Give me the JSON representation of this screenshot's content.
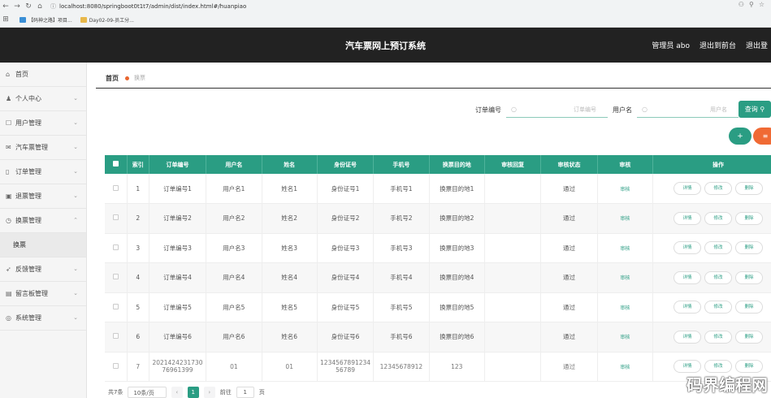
{
  "browser": {
    "url": "localhost:8080/springboot0t1t7/admin/dist/index.html#/huanpiao",
    "bookmarks": [
      "【码神之路】项目...",
      "Day02-09-员工分..."
    ]
  },
  "header": {
    "title": "汽车票网上预订系统",
    "admin": "管理员 abo",
    "back_front": "退出到前台",
    "logout": "退出登"
  },
  "sidebar": {
    "items": [
      {
        "label": "首页",
        "icon": "home-icon",
        "chev": false
      },
      {
        "label": "个人中心",
        "icon": "user-icon",
        "chev": true
      },
      {
        "label": "用户管理",
        "icon": "users-icon",
        "chev": true
      },
      {
        "label": "汽车票管理",
        "icon": "ticket-icon",
        "chev": true
      },
      {
        "label": "订单管理",
        "icon": "order-icon",
        "chev": true
      },
      {
        "label": "退票管理",
        "icon": "refund-icon",
        "chev": true
      },
      {
        "label": "换票管理",
        "icon": "exchange-icon",
        "chev": true,
        "open": true
      },
      {
        "label": "换票",
        "sub": true
      },
      {
        "label": "反馈管理",
        "icon": "feedback-icon",
        "chev": true
      },
      {
        "label": "留言板管理",
        "icon": "message-icon",
        "chev": true
      },
      {
        "label": "系统管理",
        "icon": "settings-icon",
        "chev": true
      }
    ]
  },
  "breadcrumb": {
    "home": "首页",
    "current": "换票"
  },
  "search": {
    "order_label": "订单编号",
    "order_placeholder": "订单编号",
    "user_label": "用户名",
    "user_placeholder": "用户名",
    "button": "查询"
  },
  "actions": {
    "add": "+",
    "delete": "≡"
  },
  "table": {
    "headers": [
      "",
      "索引",
      "订单编号",
      "用户名",
      "姓名",
      "身份证号",
      "手机号",
      "换票目的地",
      "审核回复",
      "审核状态",
      "审核",
      "操作"
    ],
    "audit_label": "审核",
    "op_labels": [
      "详情",
      "修改",
      "删除"
    ],
    "rows": [
      {
        "idx": "1",
        "order": "订单编号1",
        "user": "用户名1",
        "name": "姓名1",
        "idcard": "身份证号1",
        "phone": "手机号1",
        "dest": "换票目的地1",
        "reply": "",
        "status": "通过"
      },
      {
        "idx": "2",
        "order": "订单编号2",
        "user": "用户名2",
        "name": "姓名2",
        "idcard": "身份证号2",
        "phone": "手机号2",
        "dest": "换票目的地2",
        "reply": "",
        "status": "通过"
      },
      {
        "idx": "3",
        "order": "订单编号3",
        "user": "用户名3",
        "name": "姓名3",
        "idcard": "身份证号3",
        "phone": "手机号3",
        "dest": "换票目的地3",
        "reply": "",
        "status": "通过"
      },
      {
        "idx": "4",
        "order": "订单编号4",
        "user": "用户名4",
        "name": "姓名4",
        "idcard": "身份证号4",
        "phone": "手机号4",
        "dest": "换票目的地4",
        "reply": "",
        "status": "通过"
      },
      {
        "idx": "5",
        "order": "订单编号5",
        "user": "用户名5",
        "name": "姓名5",
        "idcard": "身份证号5",
        "phone": "手机号5",
        "dest": "换票目的地5",
        "reply": "",
        "status": "通过"
      },
      {
        "idx": "6",
        "order": "订单编号6",
        "user": "用户名6",
        "name": "姓名6",
        "idcard": "身份证号6",
        "phone": "手机号6",
        "dest": "换票目的地6",
        "reply": "",
        "status": "通过"
      },
      {
        "idx": "7",
        "order": "2021424231730 76961399",
        "user": "01",
        "name": "01",
        "idcard": "1234567891234 56789",
        "phone": "12345678912",
        "dest": "123",
        "reply": "",
        "status": "通过"
      }
    ]
  },
  "pager": {
    "total": "共7条",
    "size": "10条/页",
    "page": "1",
    "goto": "前往",
    "goto_val": "1",
    "unit": "页"
  },
  "watermark": "码界编程网"
}
